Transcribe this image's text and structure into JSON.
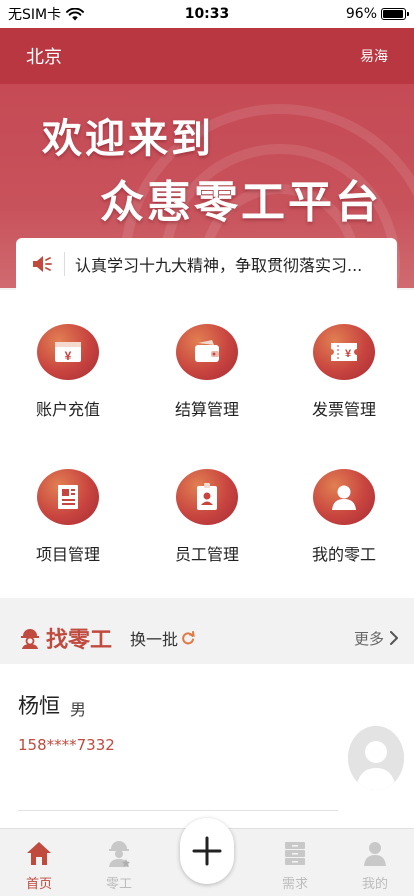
{
  "status_bar": {
    "carrier": "无SIM卡",
    "time": "10:33",
    "battery": "96%",
    "battery_level": 0.96
  },
  "header": {
    "city": "北京",
    "user": "易海"
  },
  "banner": {
    "line1": "欢迎来到",
    "line2": "众惠零工平台"
  },
  "notice": {
    "text": "认真学习十九大精神，争取贯彻落实习..."
  },
  "grid": {
    "items": [
      {
        "label": "账户充值",
        "icon": "yen-card-icon"
      },
      {
        "label": "结算管理",
        "icon": "wallet-icon"
      },
      {
        "label": "发票管理",
        "icon": "invoice-ticket-icon"
      },
      {
        "label": "项目管理",
        "icon": "document-icon"
      },
      {
        "label": "员工管理",
        "icon": "id-badge-icon"
      },
      {
        "label": "我的零工",
        "icon": "person-icon"
      }
    ]
  },
  "find_section": {
    "title": "找零工",
    "refresh": "换一批",
    "more": "更多"
  },
  "worker": {
    "name": "杨恒",
    "gender": "男",
    "phone": "158****7332"
  },
  "tabbar": {
    "items": [
      {
        "label": "首页",
        "icon": "home-icon",
        "active": true
      },
      {
        "label": "零工",
        "icon": "worker-icon",
        "active": false
      },
      {
        "label": "需求",
        "icon": "cabinet-icon",
        "active": false
      },
      {
        "label": "我的",
        "icon": "profile-icon",
        "active": false
      }
    ]
  },
  "colors": {
    "brand": "#b83741",
    "accent": "#c04a3e"
  }
}
